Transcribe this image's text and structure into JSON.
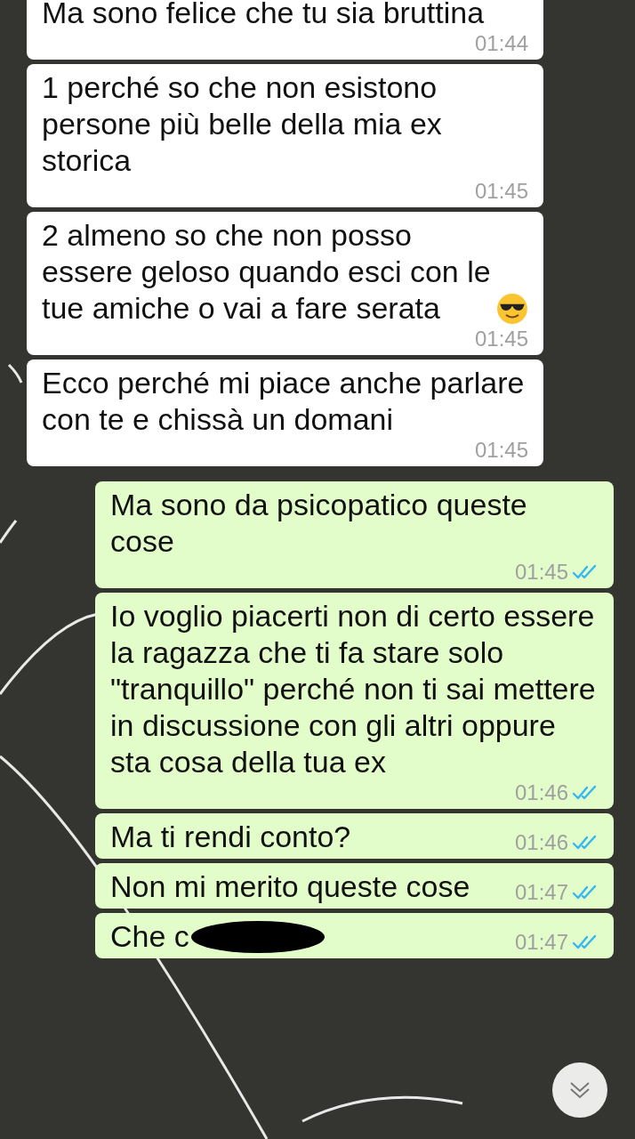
{
  "messages": [
    {
      "kind": "received",
      "text": "Ma sono felice che tu sia bruttina",
      "time": "01:44"
    },
    {
      "kind": "received",
      "text": "1 perché so che non esistono persone più belle della mia ex storica",
      "time": "01:45"
    },
    {
      "kind": "received",
      "text": "2 almeno so che non posso essere geloso quando esci con le tue amiche o vai a fare serata",
      "has_emoji": true,
      "time": "01:45"
    },
    {
      "kind": "received",
      "text": "Ecco perché mi piace anche parlare con te e chissà un domani",
      "time": "01:45"
    },
    {
      "kind": "sent",
      "text": "Ma sono da psicopatico queste cose",
      "time": "01:45",
      "read": true
    },
    {
      "kind": "sent",
      "text": "Io voglio piacerti non di certo essere la ragazza che ti fa stare solo \"tranquillo\" perché non ti sai mettere in discussione con gli altri oppure sta cosa della tua ex",
      "time": "01:46",
      "read": true
    },
    {
      "kind": "sent",
      "text": "Ma ti rendi conto?",
      "time": "01:46",
      "read": true
    },
    {
      "kind": "sent",
      "text": "Non mi merito queste cose",
      "time": "01:47",
      "read": true
    },
    {
      "kind": "sent",
      "text": "Che c",
      "redacted": true,
      "time": "01:47",
      "read": true
    }
  ],
  "scroll_down_button": true
}
